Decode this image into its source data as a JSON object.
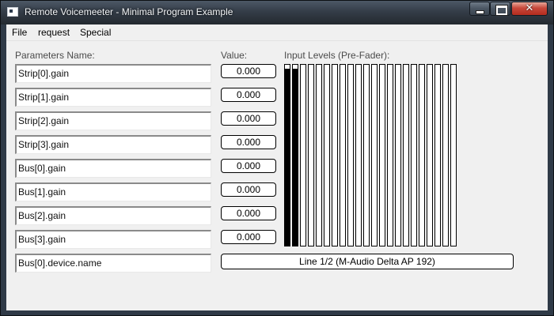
{
  "window": {
    "title": "Remote Voicemeeter - Minimal Program Example",
    "controls": {
      "minimize": "minimize",
      "maximize": "maximize",
      "close": "✕"
    }
  },
  "menu": {
    "items": [
      "File",
      "request",
      "Special"
    ]
  },
  "labels": {
    "params_header": "Parameters Name:",
    "value_header": "Value:",
    "levels_header": "Input Levels (Pre-Fader):"
  },
  "parameters": [
    {
      "name": "Strip[0].gain",
      "value": "0.000"
    },
    {
      "name": "Strip[1].gain",
      "value": "0.000"
    },
    {
      "name": "Strip[2].gain",
      "value": "0.000"
    },
    {
      "name": "Strip[3].gain",
      "value": "0.000"
    },
    {
      "name": "Bus[0].gain",
      "value": "0.000"
    },
    {
      "name": "Bus[1].gain",
      "value": "0.000"
    },
    {
      "name": "Bus[2].gain",
      "value": "0.000"
    },
    {
      "name": "Bus[3].gain",
      "value": "0.000"
    }
  ],
  "device": {
    "name": "Bus[0].device.name",
    "value": "Line 1/2 (M-Audio Delta AP 192)"
  },
  "input_levels": [
    0.98,
    0.98,
    0,
    0,
    0,
    0,
    0,
    0,
    0,
    0,
    0,
    0,
    0,
    0,
    0,
    0,
    0,
    0,
    0,
    0,
    0,
    0
  ]
}
